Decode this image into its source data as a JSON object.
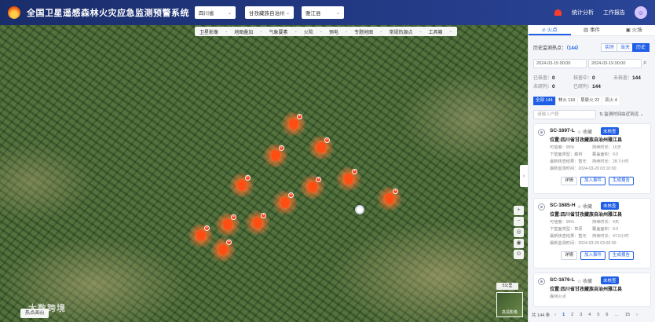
{
  "header": {
    "title": "全国卫星遥感森林火灾应急监测预警系统",
    "province": "四川省",
    "prefecture": "甘孜藏族自治州",
    "county": "雅江县",
    "stats_label": "统计分析",
    "report_label": "工作报告"
  },
  "map": {
    "toolbar": [
      "卫星影像",
      "地图叠加",
      "气象要素",
      "火险",
      "预电",
      "专题地图",
      "常规热源点",
      "工具箱"
    ],
    "fire_count": "+",
    "scale_label": "5公里",
    "minimap_label": "高清影像",
    "hotspot_button": "热点图例",
    "watermark": "大数跨境",
    "controls": [
      "+",
      "−",
      "◎",
      "◉",
      "⊙"
    ]
  },
  "panel": {
    "tabs": [
      "火点",
      "事件",
      "火场"
    ],
    "history_label": "历史监测热点：",
    "history_count": "（144）",
    "mode_realtime": "实时",
    "mode_today": "当天",
    "mode_history": "历史",
    "date_start": "2024-03-15 00:00",
    "date_end": "2024-03-19 00:00",
    "stats": {
      "confirmed_label": "已核查：",
      "confirmed_value": "0",
      "checking_label": "核查中：",
      "checking_value": "0",
      "unchecked_label": "未核查：",
      "unchecked_value": "144",
      "pending_label": "未研判：",
      "pending_value": "0",
      "judged_label": "已研判：",
      "judged_value": "144"
    },
    "filters": [
      {
        "label": "全部",
        "count": "144"
      },
      {
        "label": "林火",
        "count": "118"
      },
      {
        "label": "草原火",
        "count": "22"
      },
      {
        "label": "农火",
        "count": "4"
      }
    ],
    "search_placeholder": "请输入户籍",
    "sort_label": "监测时间由近到远",
    "cards": [
      {
        "id": "SC-1697-L",
        "star": "☆ 收藏",
        "status": "未核查",
        "location": "位置:四川省甘孜藏族自治州雅江县",
        "credibility": "可信度：95%",
        "duration": "持续时长：16天",
        "landuse": "下垫面类型：森林",
        "area": "覆盖面积：0.0",
        "latest_result": "最新核查结果：暂无",
        "persist": "持续时长：28.7小时",
        "latest_time": "最新监测时间：2024-03-20 03:10:00",
        "btn_detail": "详情",
        "btn_event": "加入事件",
        "btn_report": "生成报告"
      },
      {
        "id": "SC-1685-H",
        "star": "☆ 收藏",
        "status": "未核查",
        "location": "位置:四川省甘孜藏族自治州雅江县",
        "credibility": "可信度：95%",
        "duration": "持续时长：4天",
        "landuse": "下垫面类型：草原",
        "area": "覆盖面积：0.0",
        "latest_result": "最新核查结果：暂无",
        "persist": "持续时长：47.0小时",
        "latest_time": "最新监测时间：2024-03-20 03:00:00",
        "btn_detail": "详情",
        "btn_event": "加入事件",
        "btn_report": "生成报告"
      },
      {
        "id": "SC-1676-L",
        "star": "☆ 收藏",
        "status": "未核查",
        "location": "位置:四川省甘孜藏族自治州雅江县",
        "sub": "森林火点"
      }
    ],
    "pager": {
      "total": "共 144 条",
      "prev": "‹",
      "pages": [
        "1",
        "2",
        "3",
        "4",
        "5",
        "6",
        "…",
        "15"
      ],
      "next": "›"
    }
  }
}
